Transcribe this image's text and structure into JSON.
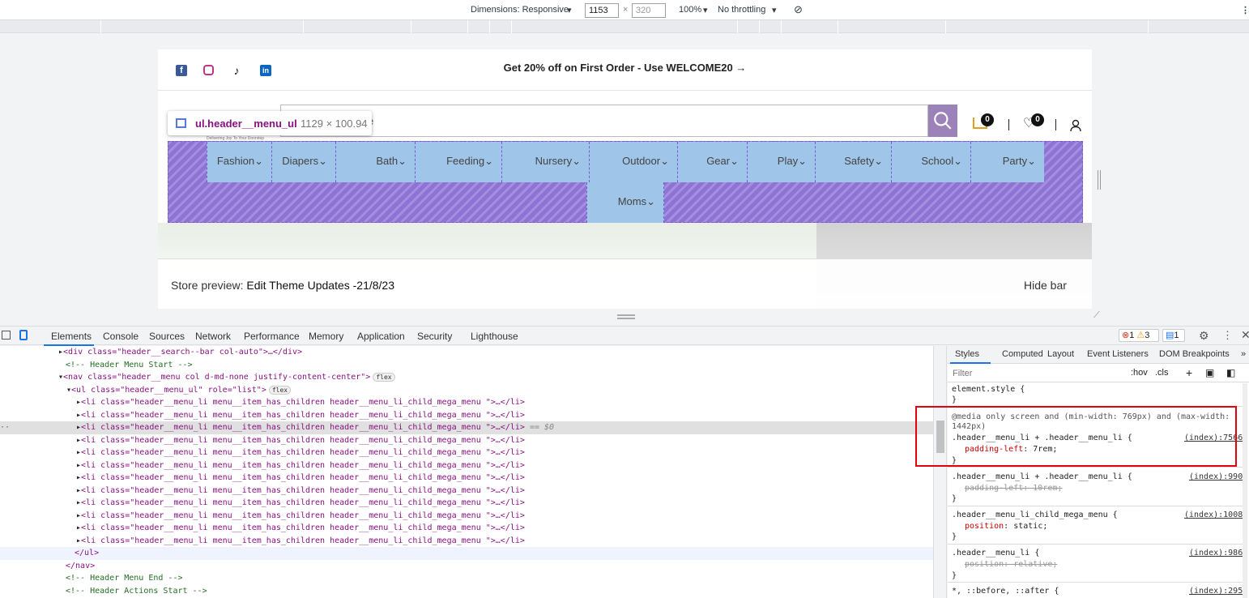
{
  "toolbar": {
    "dimensions": "Dimensions: Responsive",
    "width": "1153",
    "height": "320",
    "zoom": "100%",
    "throttle": "No throttling"
  },
  "page": {
    "promo": "Get 20% off on First Order - Use WELCOME20",
    "search_placeholder": "e",
    "cart_count": "0",
    "wish_count": "0",
    "tooltip_selector": "ul.header__menu_ul",
    "tooltip_dims": "1129 × 100.94",
    "tooltip_sub": "Delivering Joy To Your Doorstep",
    "menu": [
      "Fashion",
      "Diapers",
      "Bath",
      "Feeding",
      "Nursery",
      "Outdoor",
      "Gear",
      "Play",
      "Safety",
      "School",
      "Party",
      "Moms"
    ],
    "preview_label": "Store preview: ",
    "preview_theme": "Edit Theme Updates -21/8/23",
    "hide_bar": "Hide bar"
  },
  "devtools": {
    "tabs": [
      "Elements",
      "Console",
      "Sources",
      "Network",
      "Performance",
      "Memory",
      "Application",
      "Security",
      "Lighthouse"
    ],
    "errors": "1",
    "warnings": "3",
    "messages": "1",
    "dom": {
      "search_div": "<div class=\"header__search--bar col-auto\">…</div>",
      "comment_start": "<!-- Header Menu Start -->",
      "nav": "<nav class=\"header__menu  col d-md-none justify-content-center\">",
      "ul": "<ul class=\"header__menu_ul\" role=\"list\">",
      "li": "<li class=\"header__menu_li menu__item_has_children header__menu_li_child_mega_menu  \">…</li>",
      "selected_marker": "== $0",
      "ul_close": "</ul>",
      "nav_close": "</nav>",
      "comment_end": "<!-- Header Menu End -->",
      "comment_actions": "<!-- Header Actions Start -->",
      "flex_badge": "flex"
    },
    "styles_tabs": [
      "Styles",
      "Computed",
      "Layout",
      "Event Listeners",
      "DOM Breakpoints"
    ],
    "filter": "Filter",
    "hov": ":hov",
    "cls": ".cls",
    "rules": {
      "element_style": "element.style {",
      "close": "}",
      "media": "@media only screen and (min-width: 769px) and (max-width:",
      "media2": "1442px)",
      "sel1": ".header__menu_li + .header__menu_li {",
      "src1": "(index):7566",
      "prop1": "padding-left",
      "val1": ": 7rem;",
      "sel2": ".header__menu_li + .header__menu_li {",
      "src2": "(index):990",
      "prop2": "padding-left: 10rem;",
      "sel3": ".header__menu_li_child_mega_menu {",
      "src3": "(index):1008",
      "prop3": "position",
      "val3": ": static;",
      "sel4": ".header__menu_li {",
      "src4": "(index):986",
      "prop4": "position: relative;",
      "sel5": "*, ::before, ::after {",
      "src5": "(index):295"
    }
  }
}
